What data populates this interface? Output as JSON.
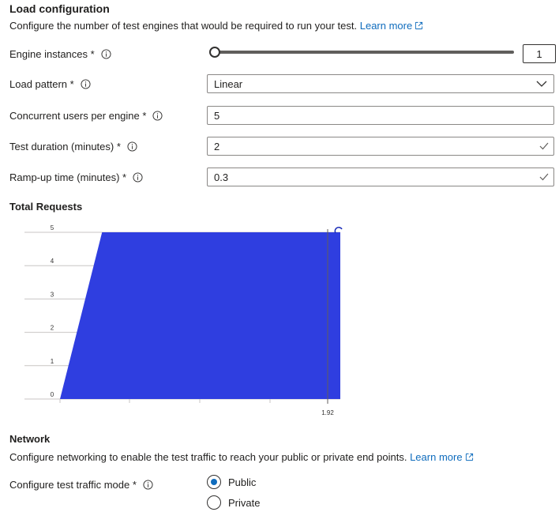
{
  "load": {
    "title": "Load configuration",
    "description": "Configure the number of test engines that would be required to run your test.",
    "learn_more": "Learn more"
  },
  "fields": {
    "engine_instances": {
      "label": "Engine instances *",
      "value": "1",
      "slider_fraction": 0.0
    },
    "load_pattern": {
      "label": "Load pattern *",
      "value": "Linear"
    },
    "concurrent_users": {
      "label": "Concurrent users per engine *",
      "value": "5"
    },
    "test_duration": {
      "label": "Test duration (minutes) *",
      "value": "2"
    },
    "ramp_up": {
      "label": "Ramp-up time (minutes) *",
      "value": "0.3"
    }
  },
  "chart_title": "Total Requests",
  "chart_data": {
    "type": "area",
    "x": [
      0,
      0.3,
      2
    ],
    "values": [
      0,
      5,
      5
    ],
    "ylim": [
      0,
      5
    ],
    "yticks": [
      "0",
      "1",
      "2",
      "3",
      "4",
      "5"
    ],
    "xticks": [
      "1.92"
    ],
    "grid": "horizontal",
    "color": "#2f3ee0"
  },
  "network": {
    "title": "Network",
    "description": "Configure networking to enable the test traffic to reach your public or private end points.",
    "learn_more": "Learn more",
    "mode_label": "Configure test traffic mode *",
    "options": [
      "Public",
      "Private"
    ],
    "selected": "Public"
  },
  "colors": {
    "accent": "#0f6cbd",
    "chart_fill": "#2f3ee0",
    "success": "#107c10"
  }
}
